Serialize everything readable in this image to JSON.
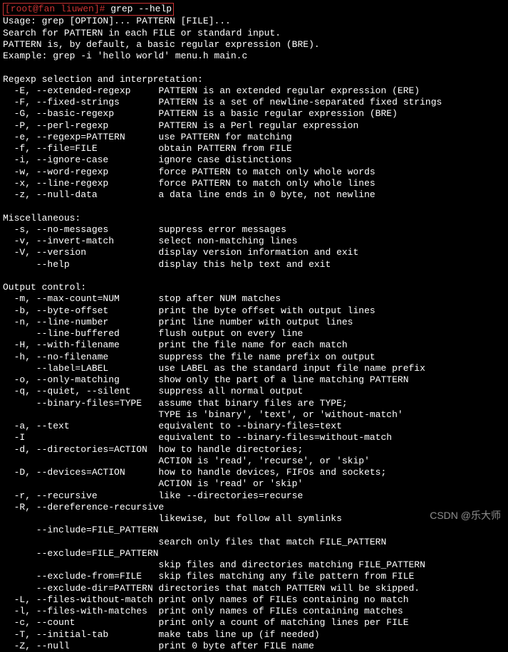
{
  "prompt": {
    "user_host": "[root@fan liuwen]#",
    "command": "grep --help"
  },
  "intro": [
    "Usage: grep [OPTION]... PATTERN [FILE]...",
    "Search for PATTERN in each FILE or standard input.",
    "PATTERN is, by default, a basic regular expression (BRE).",
    "Example: grep -i 'hello world' menu.h main.c"
  ],
  "sections": [
    {
      "title": "Regexp selection and interpretation:",
      "options": [
        {
          "flags": "-E, --extended-regexp",
          "desc": "PATTERN is an extended regular expression (ERE)"
        },
        {
          "flags": "-F, --fixed-strings",
          "desc": "PATTERN is a set of newline-separated fixed strings"
        },
        {
          "flags": "-G, --basic-regexp",
          "desc": "PATTERN is a basic regular expression (BRE)"
        },
        {
          "flags": "-P, --perl-regexp",
          "desc": "PATTERN is a Perl regular expression"
        },
        {
          "flags": "-e, --regexp=PATTERN",
          "desc": "use PATTERN for matching"
        },
        {
          "flags": "-f, --file=FILE",
          "desc": "obtain PATTERN from FILE"
        },
        {
          "flags": "-i, --ignore-case",
          "desc": "ignore case distinctions"
        },
        {
          "flags": "-w, --word-regexp",
          "desc": "force PATTERN to match only whole words"
        },
        {
          "flags": "-x, --line-regexp",
          "desc": "force PATTERN to match only whole lines"
        },
        {
          "flags": "-z, --null-data",
          "desc": "a data line ends in 0 byte, not newline"
        }
      ]
    },
    {
      "title": "Miscellaneous:",
      "options": [
        {
          "flags": "-s, --no-messages",
          "desc": "suppress error messages"
        },
        {
          "flags": "-v, --invert-match",
          "desc": "select non-matching lines"
        },
        {
          "flags": "-V, --version",
          "desc": "display version information and exit"
        },
        {
          "flags": "    --help",
          "desc": "display this help text and exit"
        }
      ]
    },
    {
      "title": "Output control:",
      "options": [
        {
          "flags": "-m, --max-count=NUM",
          "desc": "stop after NUM matches"
        },
        {
          "flags": "-b, --byte-offset",
          "desc": "print the byte offset with output lines"
        },
        {
          "flags": "-n, --line-number",
          "desc": "print line number with output lines"
        },
        {
          "flags": "    --line-buffered",
          "desc": "flush output on every line"
        },
        {
          "flags": "-H, --with-filename",
          "desc": "print the file name for each match"
        },
        {
          "flags": "-h, --no-filename",
          "desc": "suppress the file name prefix on output"
        },
        {
          "flags": "    --label=LABEL",
          "desc": "use LABEL as the standard input file name prefix"
        },
        {
          "flags": "-o, --only-matching",
          "desc": "show only the part of a line matching PATTERN"
        },
        {
          "flags": "-q, --quiet, --silent",
          "desc": "suppress all normal output"
        },
        {
          "flags": "    --binary-files=TYPE",
          "desc": "assume that binary files are TYPE;"
        },
        {
          "flags": "",
          "desc": "TYPE is 'binary', 'text', or 'without-match'"
        },
        {
          "flags": "-a, --text",
          "desc": "equivalent to --binary-files=text"
        },
        {
          "flags": "-I",
          "desc": "equivalent to --binary-files=without-match"
        },
        {
          "flags": "-d, --directories=ACTION",
          "desc": "how to handle directories;"
        },
        {
          "flags": "",
          "desc": "ACTION is 'read', 'recurse', or 'skip'"
        },
        {
          "flags": "-D, --devices=ACTION",
          "desc": "how to handle devices, FIFOs and sockets;"
        },
        {
          "flags": "",
          "desc": "ACTION is 'read' or 'skip'"
        },
        {
          "flags": "-r, --recursive",
          "desc": "like --directories=recurse"
        },
        {
          "flags": "-R, --dereference-recursive",
          "desc": ""
        },
        {
          "flags": "",
          "desc": "likewise, but follow all symlinks"
        },
        {
          "flags": "    --include=FILE_PATTERN",
          "desc": ""
        },
        {
          "flags": "",
          "desc": "search only files that match FILE_PATTERN"
        },
        {
          "flags": "    --exclude=FILE_PATTERN",
          "desc": ""
        },
        {
          "flags": "",
          "desc": "skip files and directories matching FILE_PATTERN"
        },
        {
          "flags": "    --exclude-from=FILE",
          "desc": "skip files matching any file pattern from FILE"
        },
        {
          "flags": "    --exclude-dir=PATTERN",
          "desc": "directories that match PATTERN will be skipped."
        },
        {
          "flags": "-L, --files-without-match",
          "desc": "print only names of FILEs containing no match"
        },
        {
          "flags": "-l, --files-with-matches",
          "desc": "print only names of FILEs containing matches"
        },
        {
          "flags": "-c, --count",
          "desc": "print only a count of matching lines per FILE"
        },
        {
          "flags": "-T, --initial-tab",
          "desc": "make tabs line up (if needed)"
        },
        {
          "flags": "-Z, --null",
          "desc": "print 0 byte after FILE name"
        }
      ]
    }
  ],
  "indent": {
    "option": "  ",
    "desc_col": 28
  },
  "watermark": "CSDN @乐大师"
}
